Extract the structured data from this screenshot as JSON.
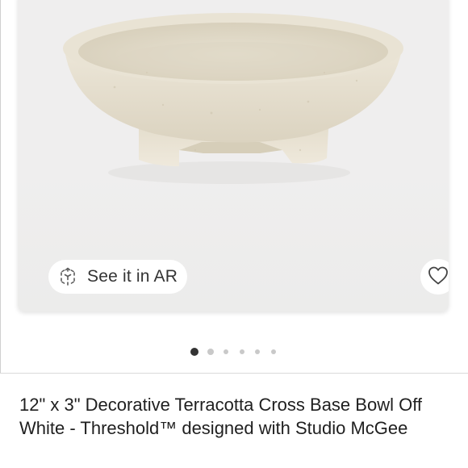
{
  "product": {
    "title": "12\" x 3\" Decorative Terracotta Cross Base Bowl Off White - Threshold™ designed with Studio McGee"
  },
  "image_card": {
    "ar_button_label": "See it in AR",
    "ar_icon": "ar-cube-icon",
    "favorite_icon": "heart-outline-icon"
  },
  "carousel": {
    "total_images": 6,
    "active_index": 0
  },
  "colors": {
    "card_background": "#efeeee",
    "active_dot": "#333333",
    "inactive_dot": "#c9c9c9",
    "text": "#1f1f1f"
  }
}
